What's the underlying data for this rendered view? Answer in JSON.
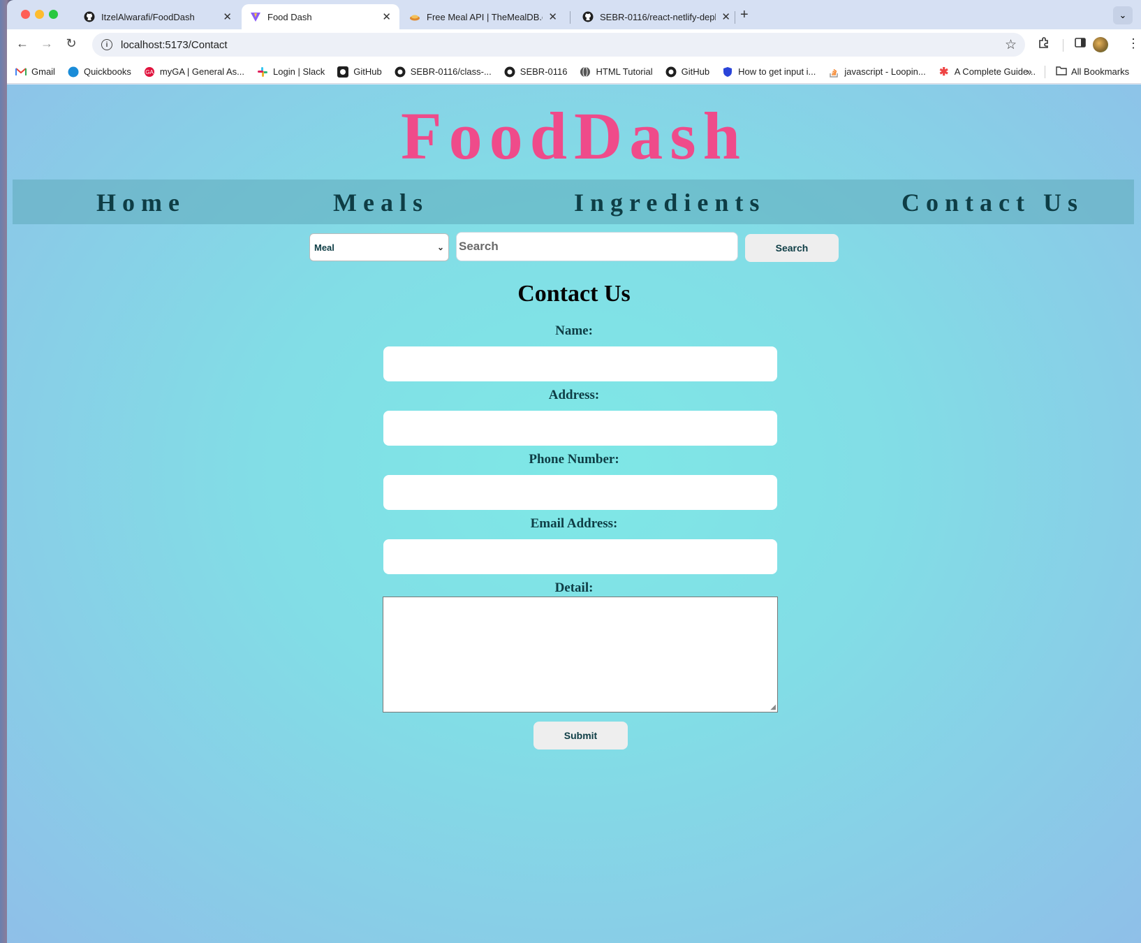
{
  "browser": {
    "tabs": [
      {
        "label": "ItzelAlwarafi/FoodDash",
        "icon": "github-icon"
      },
      {
        "label": "Food Dash",
        "icon": "vite-icon",
        "active": true
      },
      {
        "label": "Free Meal API | TheMealDB.co",
        "icon": "meal-icon"
      },
      {
        "label": "SEBR-0116/react-netlify-depl",
        "icon": "github-icon"
      }
    ],
    "url": "localhost:5173/Contact",
    "bookmarks": [
      {
        "label": "Gmail",
        "icon": "gmail-icon"
      },
      {
        "label": "Quickbooks",
        "icon": "quickbooks-icon"
      },
      {
        "label": "myGA | General As...",
        "icon": "ga-icon"
      },
      {
        "label": "Login | Slack",
        "icon": "slack-icon"
      },
      {
        "label": "GitHub",
        "icon": "github-icon"
      },
      {
        "label": "SEBR-0116/class-...",
        "icon": "github-icon"
      },
      {
        "label": "SEBR-0116",
        "icon": "github-icon"
      },
      {
        "label": "HTML Tutorial",
        "icon": "globe-icon"
      },
      {
        "label": "GitHub",
        "icon": "github-icon"
      },
      {
        "label": "How to get input i...",
        "icon": "shield-icon"
      },
      {
        "label": "javascript - Loopin...",
        "icon": "stackoverflow-icon"
      },
      {
        "label": "A Complete Guide...",
        "icon": "asterisk-icon"
      }
    ],
    "all_bookmarks": "All Bookmarks"
  },
  "site": {
    "brand": "FoodDash",
    "nav": [
      "Home",
      "Meals",
      "Ingredients",
      "Contact Us"
    ],
    "search": {
      "select_value": "Meal",
      "placeholder": "Search",
      "button": "Search"
    },
    "contact": {
      "title": "Contact Us",
      "labels": {
        "name": "Name:",
        "address": "Address:",
        "phone": "Phone Number:",
        "email": "Email Address:",
        "detail": "Detail:"
      },
      "submit": "Submit"
    }
  },
  "colors": {
    "brand": "#ef4b8a",
    "nav_text": "#0e3d45",
    "background": "#7ee8e6"
  }
}
